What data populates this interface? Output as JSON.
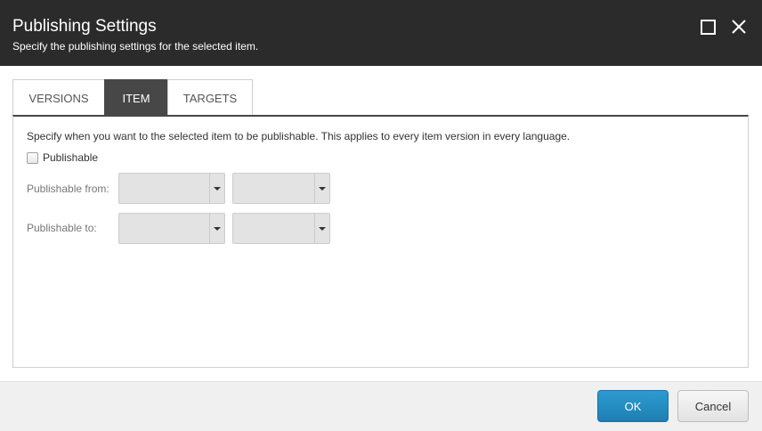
{
  "dialog": {
    "title": "Publishing Settings",
    "subtitle": "Specify the publishing settings for the selected item."
  },
  "tabs": [
    {
      "label": "VERSIONS",
      "active": false
    },
    {
      "label": "ITEM",
      "active": true
    },
    {
      "label": "TARGETS",
      "active": false
    }
  ],
  "item_tab": {
    "description": "Specify when you want to the selected item to be publishable. This applies to every item version in every language.",
    "publishable_label": "Publishable",
    "publishable_checked": false,
    "publishable_from_label": "Publishable from:",
    "publishable_to_label": "Publishable to:",
    "from_date_value": "",
    "from_time_value": "",
    "to_date_value": "",
    "to_time_value": ""
  },
  "footer": {
    "ok_label": "OK",
    "cancel_label": "Cancel"
  },
  "colors": {
    "header_bg": "#2b2b2b",
    "active_tab_bg": "#474747",
    "ok_button": "#1d7fb3"
  },
  "icons": {
    "maximize": "maximize-icon",
    "close": "close-icon",
    "dropdown": "caret-down-icon"
  }
}
